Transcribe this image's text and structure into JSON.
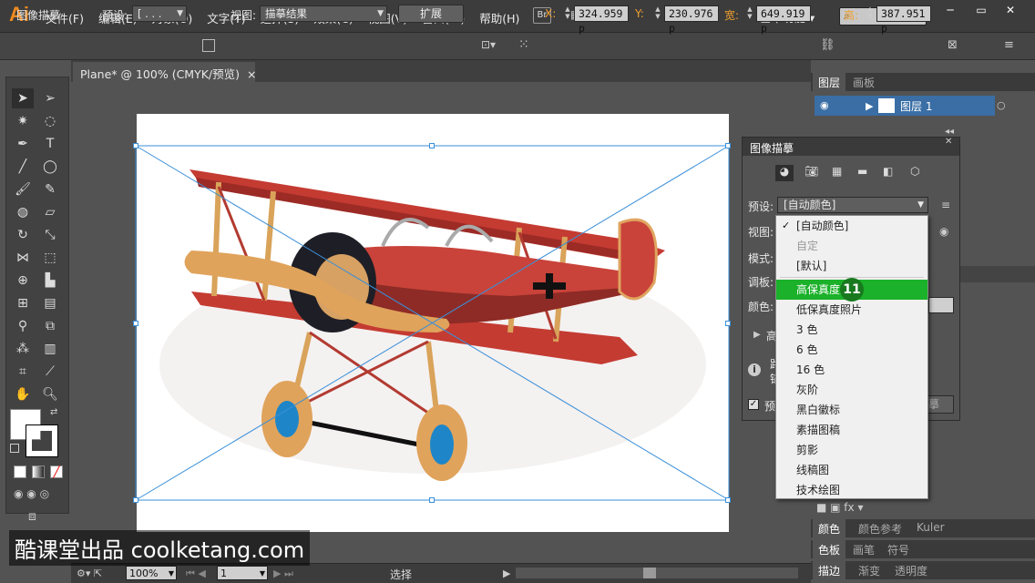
{
  "app": {
    "logo": "Ai"
  },
  "menu": [
    "文件(F)",
    "编辑(E)",
    "对象(O)",
    "文字(T)",
    "选择(S)",
    "效果(C)",
    "视图(V)",
    "窗口(W)",
    "帮助(H)"
  ],
  "top": {
    "br": "Br",
    "workspace": "基本功能",
    "workspace_arrow": "▾"
  },
  "control": {
    "panel_name": "图像描摹",
    "preset_label": "预设:",
    "preset_value": "[ . . .",
    "view_label": "视图:",
    "view_value": "描摹结果",
    "expand_button": "扩展",
    "x_label": "X:",
    "x_value": "324.959 p",
    "y_label": "Y:",
    "y_value": "230.976 p",
    "w_label": "宽:",
    "w_value": "649.919 p",
    "h_label": "高:",
    "h_value": "387.951 p"
  },
  "document": {
    "tab_title": "Plane* @ 100% (CMYK/预览)",
    "close": "×"
  },
  "layers_panel": {
    "tab_layers": "图层",
    "tab_artboards": "画板",
    "layer_name": "图层 1"
  },
  "trace_panel": {
    "title": "图像描摹",
    "preset_label": "预设:",
    "preset_value": "[自动颜色]",
    "view_label": "视图:",
    "mode_label": "模式:",
    "palette_label": "调板:",
    "color_label": "颜色:",
    "advanced_label": "高",
    "info_label": "路",
    "info_label2": "锚",
    "preview_label": "预",
    "trace_button_fragment": "摹"
  },
  "preset_options": [
    {
      "label": "[自动颜色]",
      "checked": true,
      "disabled": false
    },
    {
      "label": "自定",
      "checked": false,
      "disabled": true
    },
    {
      "label": "[默认]",
      "checked": false,
      "disabled": false
    },
    {
      "label": "高保真度照片",
      "checked": false,
      "disabled": false,
      "highlighted": true
    },
    {
      "label": "低保真度照片",
      "checked": false,
      "disabled": false
    },
    {
      "label": "3 色",
      "checked": false,
      "disabled": false
    },
    {
      "label": "6 色",
      "checked": false,
      "disabled": false
    },
    {
      "label": "16 色",
      "checked": false,
      "disabled": false
    },
    {
      "label": "灰阶",
      "checked": false,
      "disabled": false
    },
    {
      "label": "黑白徽标",
      "checked": false,
      "disabled": false
    },
    {
      "label": "素描图稿",
      "checked": false,
      "disabled": false
    },
    {
      "label": "剪影",
      "checked": false,
      "disabled": false
    },
    {
      "label": "线稿图",
      "checked": false,
      "disabled": false
    },
    {
      "label": "技术绘图",
      "checked": false,
      "disabled": false
    }
  ],
  "step_badge": "11",
  "lower_panels": {
    "tab_color": "颜色",
    "tab_color_guide": "颜色参考",
    "tab_kuler": "Kuler",
    "tab_swatches": "色板",
    "tab_brushes": "画笔",
    "tab_symbols": "符号",
    "tab_stroke": "描边",
    "tab_gradient": "渐变",
    "tab_transparency": "透明度"
  },
  "status": {
    "zoom": "100%",
    "page": "1",
    "tool": "选择"
  },
  "watermark": "酷课堂出品 coolketang.com",
  "colors": {
    "accent": "#1bb12a",
    "selection": "#3a8fd8",
    "logo": "#f08a1e"
  }
}
